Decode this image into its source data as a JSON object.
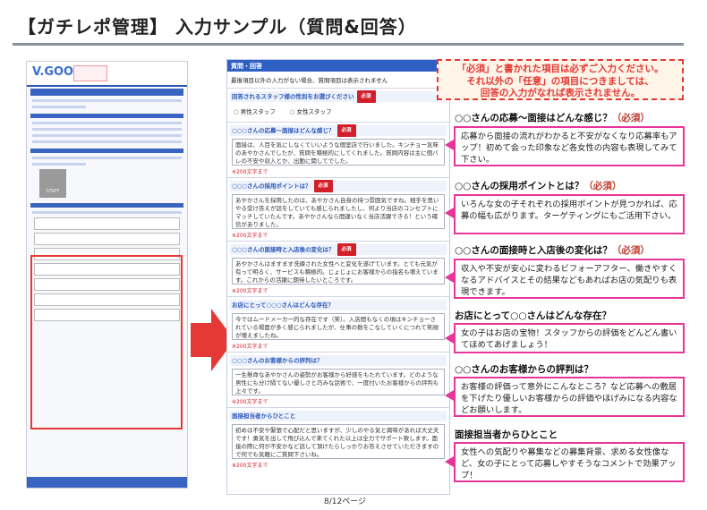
{
  "page": {
    "title": "【ガチレポ管理】 入力サンプル（質問&回答）",
    "page_number": "8/12ページ"
  },
  "thumbnail": {
    "logo": "V.GOOD",
    "staff_label": "STAFF"
  },
  "callout": {
    "line1": "「必須」と書かれた項目は必ずご入力ください。",
    "line2": "それ以外の「任意」の項目につきましては、",
    "line3": "回答の入力がなれば表示されません。"
  },
  "form": {
    "header": "質問・回答",
    "note": "最後項目以外の入力がない場合、質問項目は表示されません",
    "required_label": "必須",
    "counter": "※200文字まで",
    "gender_question": "回答されるスタッフ様の性別をお選びください",
    "gender_options": [
      "男性スタッフ",
      "女性スタッフ"
    ],
    "questions": [
      {
        "title": "○○○さんの応募～面接はどんな感じ？",
        "required": true,
        "answer": "面接は、人目を気にしなくていいような個室店で行いました。キンチョー気味のあやかさんでしたが、質問を積極的にしてくれました。質問内容は主に個バレの不安や収入とか、出勤に関してでした。"
      },
      {
        "title": "○○○さんの採用ポイントは？",
        "required": true,
        "answer": "あやかさんを採用したのは、あやかさん自身の持つ雰囲気ですね。相手を思いやる受け答えが話をしていても感じられましたし、何より当店のコンセプトにマッチしていたんです。あやかさんなら間違いなく当店活躍できる！という確信がありました。"
      },
      {
        "title": "○○○さんの面接時と入店後の変化は？",
        "required": true,
        "answer": "あやかさんはますます洗練された女性へと変化を遂げています。とても元気が有って明るく、サービスも積極的。じょじょにお客様からの指名も増えています。これからの活躍に期待したいところです。"
      },
      {
        "title": "お店にとって○○○さんはどんな存在？",
        "required": false,
        "answer": "今ではムードメーカー的な存在です（笑）。入店間もなくの頃はキンチョーされている場面が多く感じられましたが、仕事の数をこなしていくにつれて笑顔が増えましたね。"
      },
      {
        "title": "○○○さんのお客様からの評判は？",
        "required": false,
        "answer": "一生懸命なあやかさんの姿勢がお客様から好感をもたれています。どのような男性にも分け隔てない優しさと巧みな話術で、一度付いたお客様からの評判も上々です。"
      },
      {
        "title": "面接担当者からひとこと",
        "required": false,
        "answer": "初めは不安や緊張で心配だと思いますが、少しのやる気と興味があれば大丈夫です！勇気を出して飛び込んで来てくれた以上は全力でサポート致します。面接の際に何が不安かなど話して頂けたらしっかりお答えさせていただきますので何でも気軽にご質問下さいね。"
      }
    ]
  },
  "annotations": [
    {
      "title": "○○さんの応募～面接はどんな感じ？",
      "must": "（必須）",
      "body": "応募から面接の流れがわかると不安がなくなり応募率もアップ！初めて会った印象など各女性の内容も表現してみて下さい。"
    },
    {
      "title": "○○さんの採用ポイントとは？",
      "must": "（必須）",
      "body": "いろんな女の子それぞれの採用ポイントが見つかれば、応募の幅も広がります。ターゲティングにもご活用下さい。"
    },
    {
      "title": "○○さんの面接時と入店後の変化は？",
      "must": "（必須）",
      "body": "収入や不安が安心に変わるビフォーアフター、働きやすくなるアドバイスとその結果などもあればお店の気配りも表現できます。"
    },
    {
      "title": "お店にとって○○さんはどんな存在？",
      "must": "",
      "body": "女の子はお店の宝物！スタッフからの評価をどんどん書いてほめてあげましょう！"
    },
    {
      "title": "○○さんのお客様からの評判は？",
      "must": "",
      "body": "お客様の評価って意外にこんなところ？など応募への敷居を下げたり優しいお客様からの評価やほげみになる内容などお願いします。"
    },
    {
      "title": "面接担当者からひとこと",
      "must": "",
      "body": "女性への気配りや募集などの募集背景、求める女性像など、女の子にとって応募しやすそうなコメントで効果アップ！"
    }
  ],
  "colors": {
    "accent_blue": "#2e5fc4",
    "required_red": "#d21f2a",
    "callout_red": "#e53935",
    "annotation_pink": "#e7359c"
  }
}
